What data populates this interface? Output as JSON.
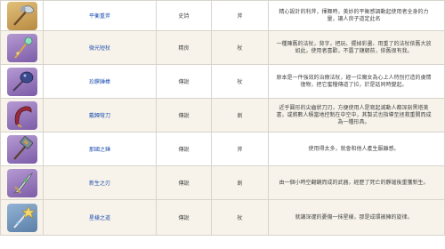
{
  "rows": [
    {
      "name": "平衡重斧",
      "rarity": "史詩",
      "type": "斧",
      "description": "精心設計的利斧，揮舞時，美妙的平衡感調動起使用者全身的力量，讓人良子道定此名",
      "icon": "axe-icon",
      "bg": "gold"
    },
    {
      "name": "微光短杖",
      "rarity": "精良",
      "type": "杖",
      "description": "一種陳舊的法杖，背字，把玩、擺掉彩畫、用重了的法杖依舊大放如此，使用者喜歡，不露了鏈朝前，依舊很有我。",
      "icon": "wand-icon",
      "bg": "purple"
    },
    {
      "name": "珍饌錘棒",
      "rarity": "傳說",
      "type": "杖",
      "description": "原本是一件強效的治療法杖，經一位魔女為心上人特別打造的虔情復物，把它蜜糧傳道了拉，於是話同時變起。",
      "icon": "mace-icon",
      "bg": "purple"
    },
    {
      "name": "戴歸彎刀",
      "rarity": "傳說",
      "type": "劍",
      "description": "近乎圓形的尖齒狀刀刃，方便使用人是寫起滅動人都深刻黑塔美書，或將數人積當地控制在中空中，其製式也指導至拯救重開而成為一種形具。",
      "icon": "sickle-icon",
      "bg": "purple"
    },
    {
      "name": "那國之錘",
      "rarity": "傳說",
      "type": "斧",
      "description": "使用得太多，就會和他人產生厭離感。",
      "icon": "warhammer-icon",
      "bg": "purple"
    },
    {
      "name": "新生之刃",
      "rarity": "傳說",
      "type": "劍",
      "description": "由一個小時空翻鏡而成的武器，經歷了死亡的靜謐後重獲新生。",
      "icon": "blade-icon",
      "bg": "purple"
    },
    {
      "name": "星樣之道",
      "rarity": "傳說",
      "type": "杖",
      "description": "就讓深邃的憂傷一抹星樣，那是成環被擁的旋律。",
      "icon": "star-staff-icon",
      "bg": "blue"
    }
  ]
}
